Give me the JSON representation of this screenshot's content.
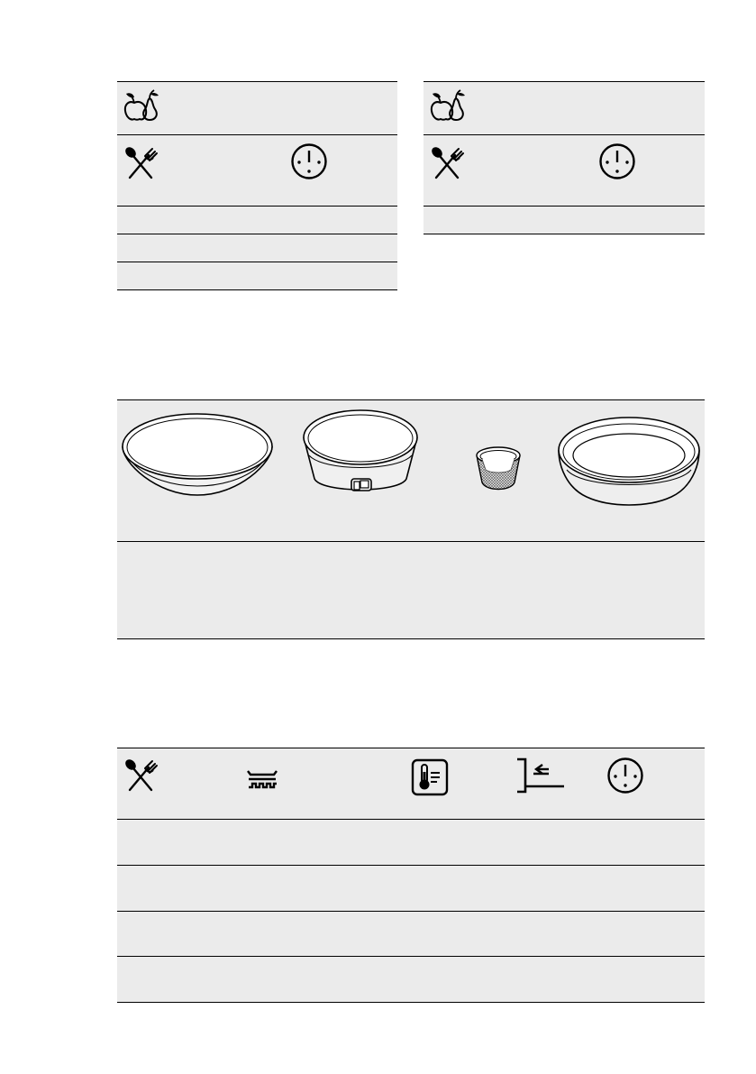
{
  "page": {
    "background": "#ffffff",
    "cell_shade": "#ebebeb",
    "rule_color": "#000000"
  },
  "table_fruit_left": {
    "header_icons": [
      "fruit-icon"
    ],
    "subheader_icons": [
      "cutlery-icon",
      "clock-icon"
    ],
    "rows": [
      [],
      [],
      []
    ]
  },
  "table_fruit_right": {
    "header_icons": [
      "fruit-icon"
    ],
    "subheader_icons": [
      "cutlery-icon",
      "clock-icon"
    ],
    "rows": [
      []
    ]
  },
  "bakeware_table": {
    "images": [
      "flat-tart-pan-icon",
      "springform-pan-icon",
      "ramekin-icon",
      "deep-pie-dish-icon"
    ],
    "rows": [
      []
    ]
  },
  "settings_table": {
    "header_icons": [
      "cutlery-icon",
      "heating-function-icon",
      "temperature-icon",
      "shelf-position-icon",
      "clock-icon"
    ],
    "rows": [
      [],
      [],
      [],
      []
    ]
  }
}
